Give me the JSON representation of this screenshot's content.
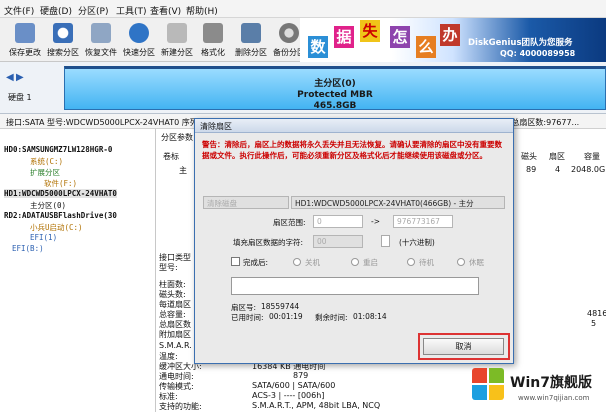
{
  "menu": [
    "文件(F)",
    "硬盘(D)",
    "分区(P)",
    "工具(T)",
    "查看(V)",
    "帮助(H)"
  ],
  "toolbar": [
    "保存更改",
    "搜索分区",
    "恢复文件",
    "快速分区",
    "新建分区",
    "格式化",
    "删除分区",
    "备份分区"
  ],
  "banner": {
    "chars": [
      "数",
      "据",
      "失",
      "怎",
      "么",
      "办"
    ],
    "brand": "DiskGenius团队为您服务",
    "qq": "QQ: 4000089958"
  },
  "disk_strip": {
    "disk_label": "硬盘 1",
    "part_name": "主分区(0)",
    "part_fs": "Protected MBR",
    "part_size": "465.8GB"
  },
  "disk_info": "接口:SATA  型号:WDCWD5000LPCX-24VHAT0  序列号:",
  "disk_info_right": "字节:63  总扇区数:97677...",
  "tree": [
    "HD0:SAMSUNGMZ7LW128HGR-0",
    "系统(C:)",
    "扩展分区",
    "软件(F:)",
    "HD1:WDCWD5000LPCX-24VHAT0",
    "主分区(0)",
    "RD2:ADATAUSBFlashDrive(30",
    "小兵U启动(C:)",
    "EFI(1)",
    "EFI(B:)"
  ],
  "right_pane": {
    "tab": "分区参数",
    "label_juanbiao": "卷标",
    "row_main": "主",
    "hdr_cizhu": "磁头",
    "hdr_shanqu": "扇区",
    "hdr_rongliang": "容量",
    "val_cizhu": "89",
    "val_shanqu": "4",
    "val_rongliang": "2048.0G",
    "labels": [
      "接口类型",
      "型号:",
      "柱面数:",
      "磁头数:",
      "每道扇区",
      "总容量:",
      "总扇区数",
      "附加扇区"
    ],
    "smart_labels": [
      "S.M.A.R.",
      "温度:",
      "缓冲区大小:",
      "通电时间:",
      "传输模式:",
      "标准:",
      "支持的功能:"
    ],
    "smart_values": [
      "",
      "",
      "16384 KB    通电时间",
      "879",
      "SATA/600 | SATA/600",
      "ACS-3 | ---- [006h]",
      "S.M.A.R.T., APM, 48bit LBA, NCQ"
    ],
    "right_nums": [
      "4816",
      "5"
    ]
  },
  "dialog": {
    "title": "清除扇区",
    "warning": "警告：清除后，扇区上的数据将永久丢失并且无法恢复。请确认要清除的扇区中没有重要数据或文件。执行此操作后，可能必须重新分区及格式化后才能继续使用该磁盘或分区。",
    "target_left": "清除磁盘",
    "target_right": "HD1:WDCWD5000LPCX-24VHAT0(466GB) - 主分",
    "range_label": "扇区范围:",
    "range_from": "0",
    "range_arrow": "->",
    "range_to": "976773167",
    "fill_label": "填充扇区数据的字符:",
    "fill_value": "00",
    "fill_hint": "(十六进制)",
    "after_label": "完成后:",
    "options": [
      "关机",
      "重启",
      "待机",
      "休眠"
    ],
    "sector_label": "扇区号:",
    "sector_value": "18559744",
    "elapsed_label": "已用时间:",
    "elapsed_value": "00:01:19",
    "remaining_label": "剩余时间:",
    "remaining_value": "01:08:14",
    "cancel": "取消"
  },
  "watermark": {
    "title": "Win7旗舰版",
    "url": "www.win7qijian.com"
  }
}
